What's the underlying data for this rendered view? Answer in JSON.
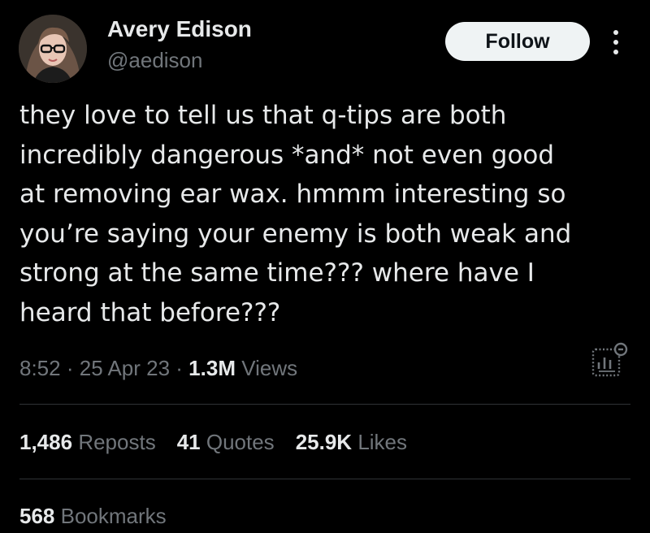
{
  "author": {
    "name": "Avery Edison",
    "handle": "@aedison"
  },
  "follow_label": "Follow",
  "tweet": {
    "lines": [
      "they love to tell us that q-tips are both",
      "incredibly dangerous *and* not even good",
      "at removing ear wax. hmmm interesting so",
      "you’re saying your enemy is both weak and",
      "strong at the same time??? where have I",
      "heard that before???"
    ]
  },
  "meta": {
    "time": "8:52",
    "date": "25 Apr 23",
    "views_count": "1.3M",
    "views_label": "Views"
  },
  "stats": {
    "reposts_count": "1,486",
    "reposts_label": "Reposts",
    "quotes_count": "41",
    "quotes_label": "Quotes",
    "likes_count": "25.9K",
    "likes_label": "Likes",
    "bookmarks_count": "568",
    "bookmarks_label": "Bookmarks"
  },
  "icons": {
    "more": "more-vertical-icon",
    "analytics": "analytics-icon"
  },
  "colors": {
    "background": "#000000",
    "text": "#e7e9ea",
    "secondary": "#71767b",
    "divider": "#2f3336",
    "button_bg": "#eff3f4"
  }
}
